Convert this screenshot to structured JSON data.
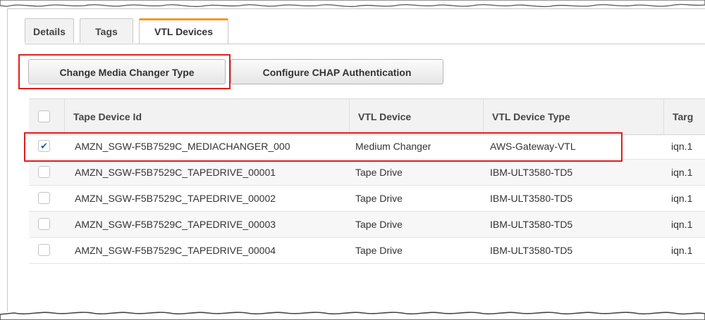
{
  "tabs": [
    {
      "label": "Details",
      "active": false
    },
    {
      "label": "Tags",
      "active": false
    },
    {
      "label": "VTL Devices",
      "active": true
    }
  ],
  "toolbar": {
    "change_media_label": "Change Media Changer Type",
    "configure_chap_label": "Configure CHAP Authentication"
  },
  "table": {
    "columns": [
      "Tape Device Id",
      "VTL Device",
      "VTL Device Type",
      "Targ"
    ],
    "rows": [
      {
        "selected": true,
        "id": "AMZN_SGW-F5B7529C_MEDIACHANGER_000",
        "device": "Medium Changer",
        "type": "AWS-Gateway-VTL",
        "target": "iqn.1"
      },
      {
        "selected": false,
        "id": "AMZN_SGW-F5B7529C_TAPEDRIVE_00001",
        "device": "Tape Drive",
        "type": "IBM-ULT3580-TD5",
        "target": "iqn.1"
      },
      {
        "selected": false,
        "id": "AMZN_SGW-F5B7529C_TAPEDRIVE_00002",
        "device": "Tape Drive",
        "type": "IBM-ULT3580-TD5",
        "target": "iqn.1"
      },
      {
        "selected": false,
        "id": "AMZN_SGW-F5B7529C_TAPEDRIVE_00003",
        "device": "Tape Drive",
        "type": "IBM-ULT3580-TD5",
        "target": "iqn.1"
      },
      {
        "selected": false,
        "id": "AMZN_SGW-F5B7529C_TAPEDRIVE_00004",
        "device": "Tape Drive",
        "type": "IBM-ULT3580-TD5",
        "target": "iqn.1"
      }
    ]
  },
  "colors": {
    "highlight": "#e01e1e",
    "active_tab_accent": "#f09b27",
    "check": "#1a5fb4"
  },
  "icons": {
    "checkmark": "checkmark-icon"
  }
}
